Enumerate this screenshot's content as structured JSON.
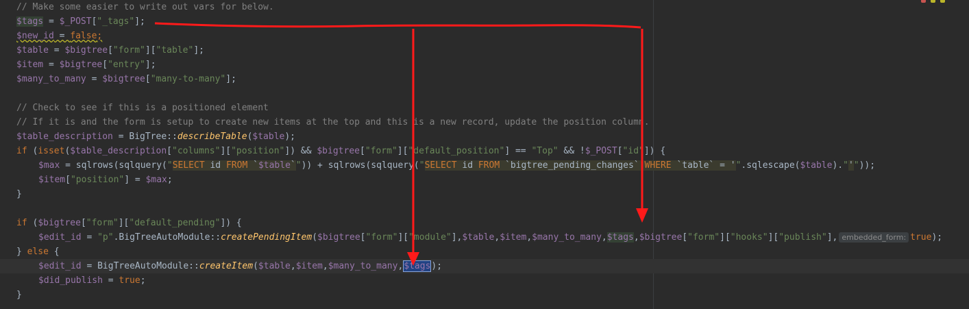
{
  "editor": {
    "lines": [
      [
        {
          "t": "// Make some easier to write out vars for below.",
          "c": "cm"
        }
      ],
      [
        {
          "t": "$tags",
          "c": "var hl-read"
        },
        {
          "t": " = ",
          "c": "plain"
        },
        {
          "t": "$_POST",
          "c": "var"
        },
        {
          "t": "[",
          "c": "plain"
        },
        {
          "t": "\"_tags\"",
          "c": "str"
        },
        {
          "t": "];",
          "c": "plain"
        }
      ],
      [
        {
          "t": "$new_id",
          "c": "var warn-under"
        },
        {
          "t": " = ",
          "c": "plain warn-under"
        },
        {
          "t": "false",
          "c": "kw warn-under"
        },
        {
          "t": ";",
          "c": "kw warn-under"
        }
      ],
      [
        {
          "t": "$table",
          "c": "var"
        },
        {
          "t": " = ",
          "c": "plain"
        },
        {
          "t": "$bigtree",
          "c": "var"
        },
        {
          "t": "[",
          "c": "plain"
        },
        {
          "t": "\"form\"",
          "c": "str"
        },
        {
          "t": "][",
          "c": "plain"
        },
        {
          "t": "\"table\"",
          "c": "str"
        },
        {
          "t": "];",
          "c": "plain"
        }
      ],
      [
        {
          "t": "$item",
          "c": "var"
        },
        {
          "t": " = ",
          "c": "plain"
        },
        {
          "t": "$bigtree",
          "c": "var"
        },
        {
          "t": "[",
          "c": "plain"
        },
        {
          "t": "\"entry\"",
          "c": "str"
        },
        {
          "t": "];",
          "c": "plain"
        }
      ],
      [
        {
          "t": "$many_to_many",
          "c": "var"
        },
        {
          "t": " = ",
          "c": "plain"
        },
        {
          "t": "$bigtree",
          "c": "var"
        },
        {
          "t": "[",
          "c": "plain"
        },
        {
          "t": "\"many-to-many\"",
          "c": "str"
        },
        {
          "t": "];",
          "c": "plain"
        }
      ],
      [],
      [
        {
          "t": "// Check to see if this is a positioned element",
          "c": "cm"
        }
      ],
      [
        {
          "t": "// If it is and the form is setup to create new items at the top and this is a new record, update the position column.",
          "c": "cm"
        }
      ],
      [
        {
          "t": "$table_description",
          "c": "var"
        },
        {
          "t": " = BigTree::",
          "c": "plain"
        },
        {
          "t": "describeTable",
          "c": "fn"
        },
        {
          "t": "(",
          "c": "plain"
        },
        {
          "t": "$table",
          "c": "var"
        },
        {
          "t": ");",
          "c": "plain"
        }
      ],
      [
        {
          "t": "if",
          "c": "kw"
        },
        {
          "t": " (",
          "c": "plain"
        },
        {
          "t": "isset",
          "c": "kw"
        },
        {
          "t": "(",
          "c": "plain"
        },
        {
          "t": "$table_description",
          "c": "var"
        },
        {
          "t": "[",
          "c": "plain"
        },
        {
          "t": "\"columns\"",
          "c": "str"
        },
        {
          "t": "][",
          "c": "plain"
        },
        {
          "t": "\"position\"",
          "c": "str"
        },
        {
          "t": "]) && ",
          "c": "plain"
        },
        {
          "t": "$bigtree",
          "c": "var"
        },
        {
          "t": "[",
          "c": "plain"
        },
        {
          "t": "\"form\"",
          "c": "str"
        },
        {
          "t": "][",
          "c": "plain"
        },
        {
          "t": "\"default_position\"",
          "c": "str"
        },
        {
          "t": "] == ",
          "c": "plain"
        },
        {
          "t": "\"Top\"",
          "c": "str"
        },
        {
          "t": " && !",
          "c": "plain"
        },
        {
          "t": "$_POST",
          "c": "var"
        },
        {
          "t": "[",
          "c": "plain"
        },
        {
          "t": "\"id\"",
          "c": "str"
        },
        {
          "t": "]) {",
          "c": "plain"
        }
      ],
      [
        {
          "t": "",
          "c": "indent"
        },
        {
          "t": "$max",
          "c": "var"
        },
        {
          "t": " = sqlrows(sqlquery(",
          "c": "plain"
        },
        {
          "t": "\"",
          "c": "str"
        },
        {
          "t": "SELECT",
          "c": "sqlkw sqlbg"
        },
        {
          "t": " id ",
          "c": "plain sqlbg"
        },
        {
          "t": "FROM",
          "c": "sqlkw sqlbg"
        },
        {
          "t": " `",
          "c": "plain sqlbg"
        },
        {
          "t": "$table",
          "c": "var sqlbg"
        },
        {
          "t": "`",
          "c": "plain sqlbg"
        },
        {
          "t": "\"",
          "c": "str"
        },
        {
          "t": ")) + sqlrows(sqlquery(",
          "c": "plain"
        },
        {
          "t": "\"",
          "c": "str"
        },
        {
          "t": "SELECT",
          "c": "sqlkw sqlbg"
        },
        {
          "t": " id ",
          "c": "plain sqlbg"
        },
        {
          "t": "FROM",
          "c": "sqlkw sqlbg"
        },
        {
          "t": " `bigtree_pending_changes` ",
          "c": "plain sqlbg"
        },
        {
          "t": "WHERE",
          "c": "sqlkw sqlbg"
        },
        {
          "t": " `table` = '",
          "c": "plain sqlbg"
        },
        {
          "t": "\"",
          "c": "str"
        },
        {
          "t": ".sqlescape(",
          "c": "plain"
        },
        {
          "t": "$table",
          "c": "var"
        },
        {
          "t": ").",
          "c": "plain"
        },
        {
          "t": "\"",
          "c": "str"
        },
        {
          "t": "'",
          "c": "plain sqlbg"
        },
        {
          "t": "\"",
          "c": "str"
        },
        {
          "t": "));",
          "c": "plain"
        }
      ],
      [
        {
          "t": "",
          "c": "indent"
        },
        {
          "t": "$item",
          "c": "var"
        },
        {
          "t": "[",
          "c": "plain"
        },
        {
          "t": "\"position\"",
          "c": "str"
        },
        {
          "t": "] = ",
          "c": "plain"
        },
        {
          "t": "$max",
          "c": "var"
        },
        {
          "t": ";",
          "c": "plain"
        }
      ],
      [
        {
          "t": "}",
          "c": "plain"
        }
      ],
      [],
      [
        {
          "t": "if",
          "c": "kw"
        },
        {
          "t": " (",
          "c": "plain"
        },
        {
          "t": "$bigtree",
          "c": "var"
        },
        {
          "t": "[",
          "c": "plain"
        },
        {
          "t": "\"form\"",
          "c": "str"
        },
        {
          "t": "][",
          "c": "plain"
        },
        {
          "t": "\"default_pending\"",
          "c": "str"
        },
        {
          "t": "]) {",
          "c": "plain"
        }
      ],
      [
        {
          "t": "",
          "c": "indent"
        },
        {
          "t": "$edit_id",
          "c": "var"
        },
        {
          "t": " = ",
          "c": "plain"
        },
        {
          "t": "\"p\"",
          "c": "str"
        },
        {
          "t": ".BigTreeAutoModule::",
          "c": "plain"
        },
        {
          "t": "createPendingItem",
          "c": "fn"
        },
        {
          "t": "(",
          "c": "plain"
        },
        {
          "t": "$bigtree",
          "c": "var"
        },
        {
          "t": "[",
          "c": "plain"
        },
        {
          "t": "\"form\"",
          "c": "str"
        },
        {
          "t": "][",
          "c": "plain"
        },
        {
          "t": "\"module\"",
          "c": "str"
        },
        {
          "t": "],",
          "c": "plain"
        },
        {
          "t": "$table",
          "c": "var"
        },
        {
          "t": ",",
          "c": "plain"
        },
        {
          "t": "$item",
          "c": "var"
        },
        {
          "t": ",",
          "c": "plain"
        },
        {
          "t": "$many_to_many",
          "c": "var"
        },
        {
          "t": ",",
          "c": "plain"
        },
        {
          "t": "$tags",
          "c": "var hl-read"
        },
        {
          "t": ",",
          "c": "plain"
        },
        {
          "t": "$bigtree",
          "c": "var"
        },
        {
          "t": "[",
          "c": "plain"
        },
        {
          "t": "\"form\"",
          "c": "str"
        },
        {
          "t": "][",
          "c": "plain"
        },
        {
          "t": "\"hooks\"",
          "c": "str"
        },
        {
          "t": "][",
          "c": "plain"
        },
        {
          "t": "\"publish\"",
          "c": "str"
        },
        {
          "t": "],",
          "c": "plain"
        },
        {
          "t": "embedded_form:",
          "c": "hint"
        },
        {
          "t": "true",
          "c": "kw"
        },
        {
          "t": ");",
          "c": "plain"
        }
      ],
      [
        {
          "t": "} ",
          "c": "plain"
        },
        {
          "t": "else",
          "c": "kw"
        },
        {
          "t": " {",
          "c": "plain"
        }
      ],
      [
        {
          "t": "",
          "c": "indent"
        },
        {
          "t": "$edit_id",
          "c": "var"
        },
        {
          "t": " = BigTreeAutoModule::",
          "c": "plain"
        },
        {
          "t": "createItem",
          "c": "fn"
        },
        {
          "t": "(",
          "c": "plain"
        },
        {
          "t": "$table",
          "c": "var"
        },
        {
          "t": ",",
          "c": "plain"
        },
        {
          "t": "$item",
          "c": "var"
        },
        {
          "t": ",",
          "c": "plain"
        },
        {
          "t": "$many_to_many",
          "c": "var"
        },
        {
          "t": ",",
          "c": "plain"
        },
        {
          "t": "$tags",
          "c": "var hl-write"
        },
        {
          "t": ");",
          "c": "plain"
        }
      ],
      [
        {
          "t": "",
          "c": "indent"
        },
        {
          "t": "$did_publish",
          "c": "var"
        },
        {
          "t": " = ",
          "c": "plain"
        },
        {
          "t": "true",
          "c": "kw"
        },
        {
          "t": ";",
          "c": "plain"
        }
      ],
      [
        {
          "t": "}",
          "c": "plain"
        }
      ]
    ]
  },
  "colors": {
    "background": "#2b2b2b",
    "annotation": "#ff1a1a",
    "usage_highlight": "#344134",
    "selection_highlight": "#214283"
  },
  "icons": {
    "inspection": "inspection-status-icon",
    "annotation_arrow": "red-arrow"
  }
}
